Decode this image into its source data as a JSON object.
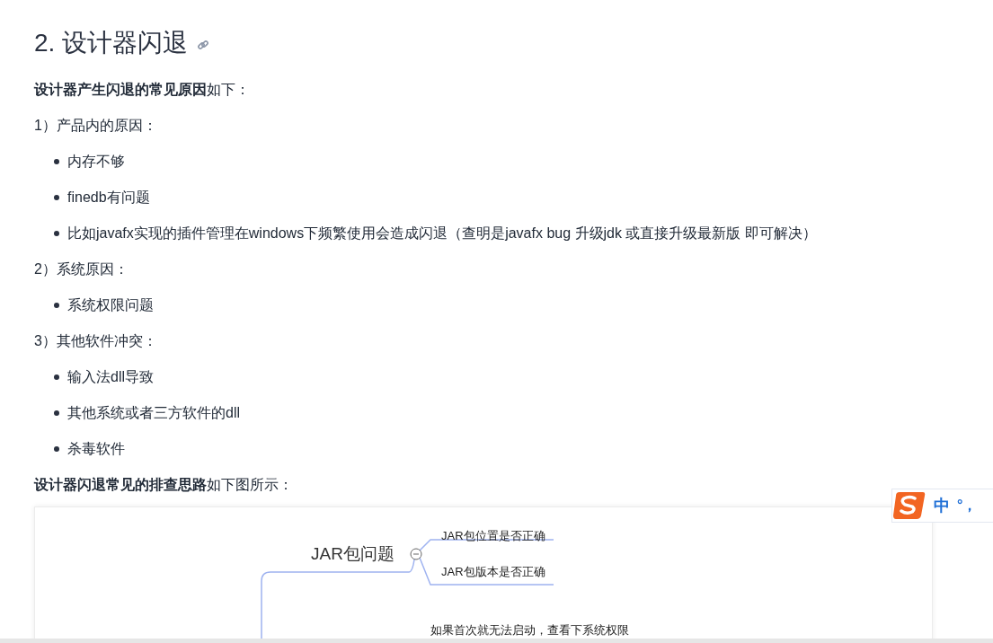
{
  "heading": {
    "number": "2.",
    "title": "设计器闪退"
  },
  "blocks": [
    {
      "kind": "paragraph",
      "text": "**设计器产生闪退的常见原因**如下："
    },
    {
      "kind": "paragraph",
      "text": "1）产品内的原因："
    },
    {
      "kind": "list",
      "items": [
        "内存不够",
        "finedb有问题",
        "比如javafx实现的插件管理在windows下频繁使用会造成闪退（查明是javafx bug 升级jdk 或直接升级最新版 即可解决）"
      ]
    },
    {
      "kind": "paragraph",
      "text": "2）系统原因："
    },
    {
      "kind": "list",
      "items": [
        "系统权限问题"
      ]
    },
    {
      "kind": "paragraph",
      "text": "3）其他软件冲突："
    },
    {
      "kind": "list",
      "items": [
        "输入法dll导致",
        "其他系统或者三方软件的dll",
        "杀毒软件"
      ]
    },
    {
      "kind": "paragraph",
      "text": "**设计器闪退常见的排查思路**如下图所示："
    },
    {
      "kind": "mindmap",
      "topic": "JAR包问题",
      "branches": [
        "JAR包位置是否正确",
        "JAR包版本是否正确"
      ],
      "note": "如果首次就无法启动，查看下系统权限"
    }
  ],
  "ime_toolbar": {
    "mode": "中",
    "punctuation": "°，"
  }
}
